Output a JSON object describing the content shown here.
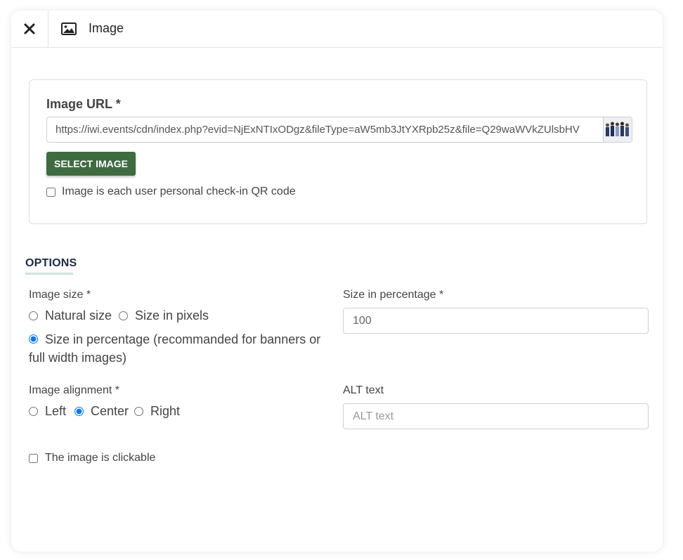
{
  "header": {
    "title": "Image",
    "close_icon": "close-icon",
    "image_icon": "image-icon"
  },
  "url_section": {
    "label": "Image URL *",
    "url_value": "https://iwi.events/cdn/index.php?evid=NjExNTIxODgz&fileType=aW5mb3JtYXRpb25z&file=Q29waWVkZUlsbHV",
    "select_button": "SELECT IMAGE",
    "qr_checkbox_label": "Image is each user personal check-in QR code",
    "qr_checked": false
  },
  "options": {
    "title": "OPTIONS",
    "image_size": {
      "label": "Image size *",
      "natural": "Natural size",
      "pixels": "Size in pixels",
      "percentage": "Size in percentage (recommanded for banners or full width images)",
      "selected": "percentage"
    },
    "size_percentage": {
      "label": "Size in percentage *",
      "value": "100"
    },
    "alignment": {
      "label": "Image alignment *",
      "left": "Left",
      "center": "Center",
      "right": "Right",
      "selected": "center"
    },
    "alt_text": {
      "label": "ALT text",
      "placeholder": "ALT text",
      "value": ""
    },
    "clickable_label": "The image is clickable",
    "clickable_checked": false
  },
  "colors": {
    "primary_button": "#3f6b41",
    "radio_accent": "#1a73e8",
    "options_title": "#1d2a44",
    "options_underline": "#cfe3de"
  }
}
